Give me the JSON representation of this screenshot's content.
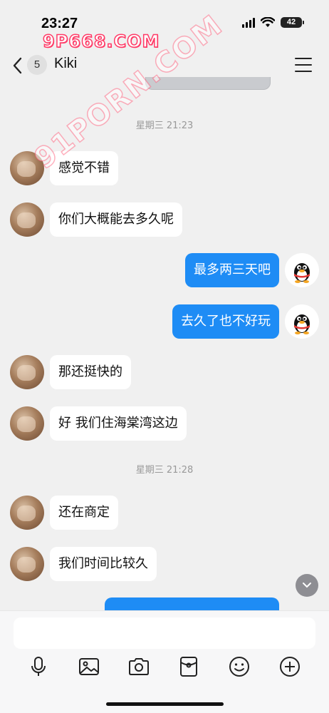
{
  "status_bar": {
    "time": "23:27",
    "battery": "42"
  },
  "watermark": {
    "top": "9P668.COM",
    "diagonal": "91PORN.COM"
  },
  "nav": {
    "unread_count": "5",
    "contact_name": "Kiki"
  },
  "conversation": {
    "dividers": [
      "星期三 21:23",
      "星期三 21:28"
    ],
    "messages": [
      {
        "sender": "contact",
        "text": "感觉不错"
      },
      {
        "sender": "contact",
        "text": "你们大概能去多久呢"
      },
      {
        "sender": "me",
        "text": "最多两三天吧"
      },
      {
        "sender": "me",
        "text": "去久了也不好玩"
      },
      {
        "sender": "contact",
        "text": "那还挺快的"
      },
      {
        "sender": "contact",
        "text": "好 我们住海棠湾这边"
      },
      {
        "sender": "contact",
        "text": "还在商定"
      },
      {
        "sender": "contact",
        "text": "我们时间比较久"
      }
    ]
  },
  "composer": {
    "input_value": "",
    "tools": [
      "microphone-icon",
      "image-icon",
      "camera-icon",
      "red-packet-icon",
      "emoji-icon",
      "plus-icon"
    ]
  },
  "colors": {
    "accent": "#1e8cf5",
    "background": "#f0f0f0",
    "watermark": "#ff3b67"
  }
}
